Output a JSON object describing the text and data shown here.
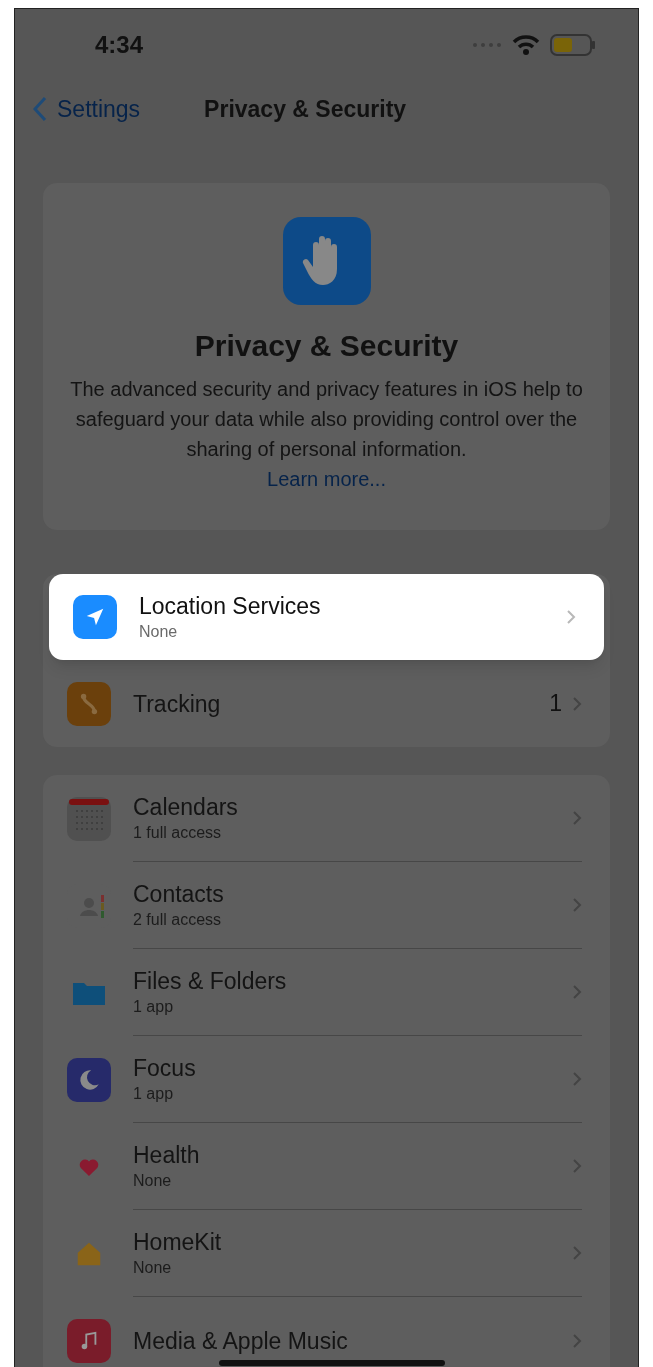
{
  "status_bar": {
    "time": "4:34"
  },
  "nav": {
    "back": "Settings",
    "title": "Privacy & Security"
  },
  "header": {
    "title": "Privacy & Security",
    "description": "The advanced security and privacy features in iOS help to safeguard your data while also providing control over the sharing of personal information.",
    "link": "Learn more..."
  },
  "groups": [
    {
      "rows": [
        {
          "kind": "location",
          "title": "Location Services",
          "subtitle": "None",
          "selected": true
        },
        {
          "kind": "tracking",
          "title": "Tracking",
          "value": "1",
          "selected": false
        }
      ]
    },
    {
      "rows": [
        {
          "kind": "calendar",
          "title": "Calendars",
          "subtitle": "1 full access",
          "selected": false
        },
        {
          "kind": "contacts",
          "title": "Contacts",
          "subtitle": "2 full access",
          "selected": false
        },
        {
          "kind": "files",
          "title": "Files & Folders",
          "subtitle": "1 app",
          "selected": false
        },
        {
          "kind": "focus",
          "title": "Focus",
          "subtitle": "1 app",
          "selected": false
        },
        {
          "kind": "health",
          "title": "Health",
          "subtitle": "None",
          "selected": false
        },
        {
          "kind": "homekit",
          "title": "HomeKit",
          "subtitle": "None",
          "selected": false
        },
        {
          "kind": "music",
          "title": "Media & Apple Music",
          "selected": false
        }
      ]
    }
  ]
}
